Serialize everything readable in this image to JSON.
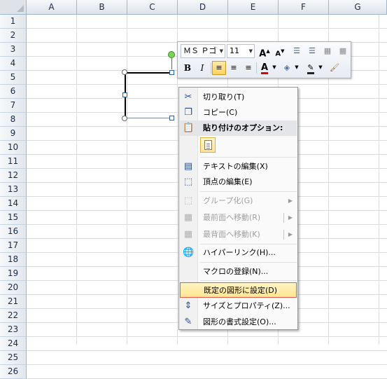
{
  "columns": [
    "A",
    "B",
    "C",
    "D",
    "E",
    "F",
    "G"
  ],
  "rows": [
    "1",
    "2",
    "3",
    "4",
    "5",
    "6",
    "7",
    "8",
    "9",
    "10",
    "11",
    "12",
    "13",
    "14",
    "15",
    "16",
    "17",
    "18",
    "19",
    "20",
    "21",
    "22",
    "23",
    "24",
    "25",
    "26"
  ],
  "mini_toolbar": {
    "font_name": "ＭＳ Ｐゴ",
    "font_size": "11",
    "grow_font_label": "A",
    "shrink_font_label": "A",
    "bold_label": "B",
    "italic_label": "I",
    "font_color_label": "A",
    "accent": "#c0504d"
  },
  "context_menu": {
    "items": [
      {
        "label": "切り取り(T)",
        "icon": "scissors-icon",
        "enabled": true
      },
      {
        "label": "コピー(C)",
        "icon": "copy-icon",
        "enabled": true
      },
      {
        "label": "貼り付けのオプション:",
        "icon": "clipboard-icon",
        "enabled": true,
        "header": true
      },
      {
        "label": "テキストの編集(X)",
        "icon": "edit-text-icon",
        "enabled": true
      },
      {
        "label": "頂点の編集(E)",
        "icon": "edit-points-icon",
        "enabled": true
      },
      {
        "label": "グループ化(G)",
        "icon": "group-icon",
        "enabled": false,
        "submenu": true
      },
      {
        "label": "最前面へ移動(R)",
        "icon": "bring-front-icon",
        "enabled": false,
        "submenu": true
      },
      {
        "label": "最背面へ移動(K)",
        "icon": "send-back-icon",
        "enabled": false,
        "submenu": true
      },
      {
        "label": "ハイパーリンク(H)...",
        "icon": "hyperlink-icon",
        "enabled": true
      },
      {
        "label": "マクロの登録(N)...",
        "icon": "",
        "enabled": true
      },
      {
        "label": "既定の図形に設定(D)",
        "icon": "",
        "enabled": true,
        "highlighted": true
      },
      {
        "label": "サイズとプロパティ(Z)...",
        "icon": "size-properties-icon",
        "enabled": true
      },
      {
        "label": "図形の書式設定(O)...",
        "icon": "format-shape-icon",
        "enabled": true
      }
    ],
    "highlight_border": "#e15b4b"
  }
}
